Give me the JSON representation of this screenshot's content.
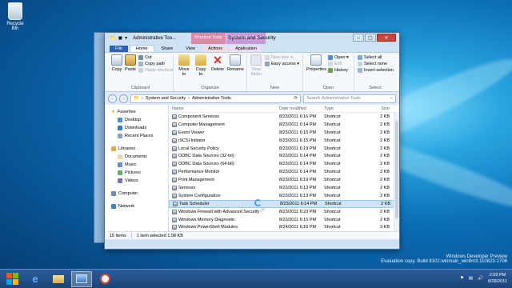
{
  "desktop": {
    "recycle_bin_label": "Recycle Bin"
  },
  "window": {
    "title": "System and Security",
    "qat_folder_title": "Administrative Too...",
    "context_tab_shortcut": "Shortcut Tools",
    "context_tab_application": "Application Tools",
    "buttons": {
      "minimize": "–",
      "maximize": "▢",
      "close": "✕"
    }
  },
  "ribbon_tabs": [
    "File",
    "Home",
    "Share",
    "View",
    "Actions",
    "Application"
  ],
  "ribbon": {
    "clipboard": {
      "copy": "Copy",
      "paste": "Paste",
      "cut": "Cut",
      "copy_path": "Copy path",
      "paste_shortcut": "Paste shortcut",
      "label": "Clipboard"
    },
    "organize": {
      "move_to": "Move to",
      "copy_to": "Copy to",
      "delete": "Delete",
      "rename": "Rename",
      "label": "Organize"
    },
    "new": {
      "new_folder": "New folder",
      "new_item": "New item ▾",
      "easy_access": "Easy access ▾",
      "label": "New"
    },
    "open": {
      "properties": "Properties",
      "open": "Open ▾",
      "edit": "Edit",
      "history": "History",
      "label": "Open"
    },
    "select": {
      "select_all": "Select all",
      "select_none": "Select none",
      "invert_selection": "Invert selection",
      "label": "Select"
    }
  },
  "address": {
    "path": [
      "System and Security",
      "Administrative Tools"
    ],
    "search_placeholder": "Search Administrative Tools"
  },
  "nav": {
    "favorites": "Favorites",
    "favorite_items": [
      "Desktop",
      "Downloads",
      "Recent Places"
    ],
    "libraries": "Libraries",
    "library_items": [
      "Documents",
      "Music",
      "Pictures",
      "Videos"
    ],
    "computer": "Computer",
    "network": "Network"
  },
  "columns": {
    "name": "Name",
    "date": "Date modified",
    "type": "Type",
    "size": "Size"
  },
  "files": [
    {
      "name": "Component Services",
      "date": "8/23/2011 6:16 PM",
      "type": "Shortcut",
      "size": "2 KB"
    },
    {
      "name": "Computer Management",
      "date": "8/23/2011 6:14 PM",
      "type": "Shortcut",
      "size": "2 KB"
    },
    {
      "name": "Event Viewer",
      "date": "8/23/2011 6:15 PM",
      "type": "Shortcut",
      "size": "2 KB"
    },
    {
      "name": "iSCSI Initiator",
      "date": "8/23/2011 6:15 PM",
      "type": "Shortcut",
      "size": "2 KB"
    },
    {
      "name": "Local Security Policy",
      "date": "8/23/2011 6:19 PM",
      "type": "Shortcut",
      "size": "2 KB"
    },
    {
      "name": "ODBC Data Sources (32-bit)",
      "date": "8/23/2011 6:14 PM",
      "type": "Shortcut",
      "size": "2 KB"
    },
    {
      "name": "ODBC Data Sources (64-bit)",
      "date": "8/23/2011 6:14 PM",
      "type": "Shortcut",
      "size": "2 KB"
    },
    {
      "name": "Performance Monitor",
      "date": "8/23/2011 6:14 PM",
      "type": "Shortcut",
      "size": "2 KB"
    },
    {
      "name": "Print Management",
      "date": "8/23/2011 6:19 PM",
      "type": "Shortcut",
      "size": "2 KB"
    },
    {
      "name": "Services",
      "date": "8/23/2011 6:13 PM",
      "type": "Shortcut",
      "size": "2 KB"
    },
    {
      "name": "System Configuration",
      "date": "8/23/2011 6:13 PM",
      "type": "Shortcut",
      "size": "2 KB"
    },
    {
      "name": "Task Scheduler",
      "date": "8/23/2011 6:14 PM",
      "type": "Shortcut",
      "size": "2 KB",
      "selected": true
    },
    {
      "name": "Windows Firewall with Advanced Security",
      "date": "8/23/2011 6:23 PM",
      "type": "Shortcut",
      "size": "2 KB"
    },
    {
      "name": "Windows Memory Diagnostic",
      "date": "8/23/2011 6:15 PM",
      "type": "Shortcut",
      "size": "2 KB"
    },
    {
      "name": "Windows PowerShell Modules",
      "date": "8/24/2011 6:16 PM",
      "type": "Shortcut",
      "size": "3 KB"
    }
  ],
  "status": {
    "items": "15 items",
    "selected": "1 item selected  1.08 KB"
  },
  "watermark": {
    "line1": "Windows Developer Preview",
    "line2": "Evaluation copy. Build 8102.winmain_win8m3.110823-1708"
  },
  "clock": {
    "time": "2:59 PM",
    "date": "8/28/2011"
  }
}
